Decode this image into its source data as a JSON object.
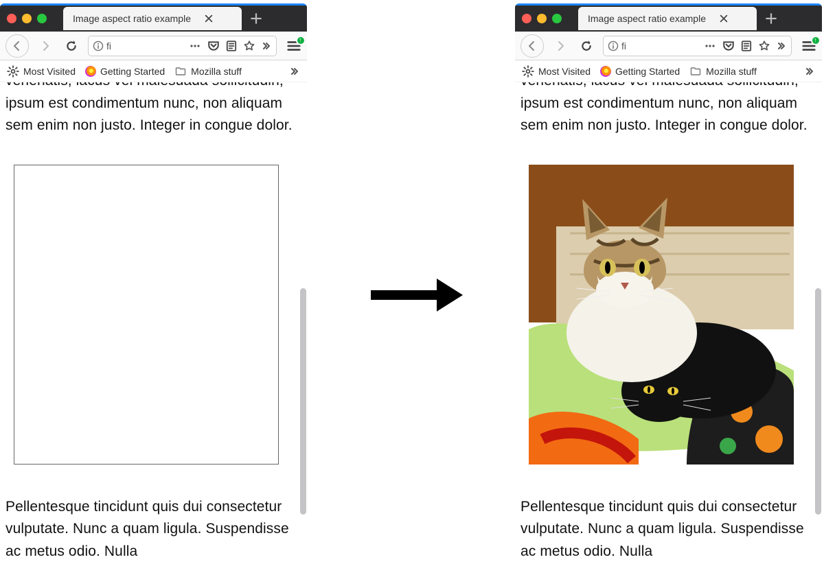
{
  "tab": {
    "title": "Image aspect ratio example"
  },
  "url_input": {
    "value": "fi"
  },
  "bookmarks": [
    {
      "label": "Most Visited",
      "icon": "gear-icon"
    },
    {
      "label": "Getting Started",
      "icon": "firefox-icon"
    },
    {
      "label": "Mozilla stuff",
      "icon": "folder-icon"
    }
  ],
  "paragraph_top": "venenatis, lacus vel malesuada sollicitudin, ipsum est condimentum nunc, non aliquam sem enim non justo. Integer in congue dolor.",
  "paragraph_bottom": "Pellentesque tincidunt quis dui consectetur vulputate. Nunc a quam ligula. Suspendisse ac metus odio. Nulla"
}
